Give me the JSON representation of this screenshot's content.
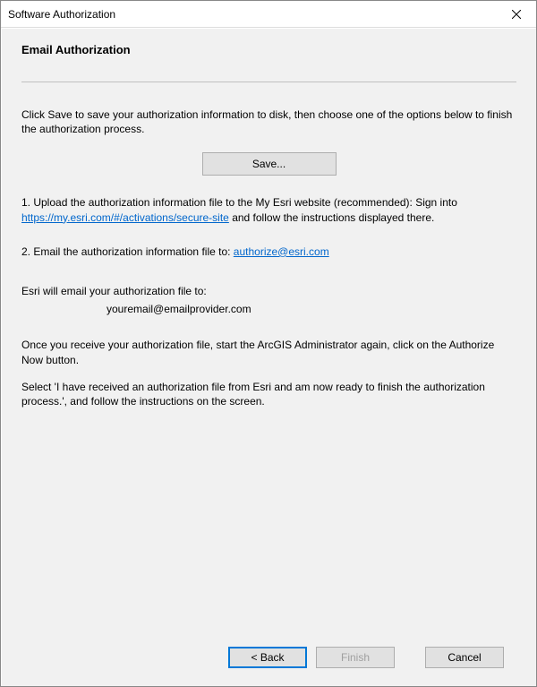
{
  "window": {
    "title": "Software Authorization"
  },
  "heading": "Email Authorization",
  "intro": "Click Save to save your authorization information to disk, then choose one of the options below to finish the authorization process.",
  "save_button": "Save...",
  "step1": {
    "prefix": "1.  Upload the authorization information file to the My Esri website (recommended): Sign into ",
    "link": "https://my.esri.com/#/activations/secure-site",
    "suffix": " and follow the instructions displayed there."
  },
  "step2": {
    "prefix": "2.  Email the authorization information file to: ",
    "link": "authorize@esri.com"
  },
  "email_notice": {
    "label": "Esri will email your authorization file to:",
    "email": "youremail@emailprovider.com"
  },
  "instr1": "Once you receive your authorization file, start the ArcGIS Administrator again, click on the Authorize Now button.",
  "instr2": "Select 'I have received an authorization file from Esri and am now ready to finish the authorization process.', and follow the instructions on the screen.",
  "footer": {
    "back": "< Back",
    "finish": "Finish",
    "cancel": "Cancel"
  }
}
